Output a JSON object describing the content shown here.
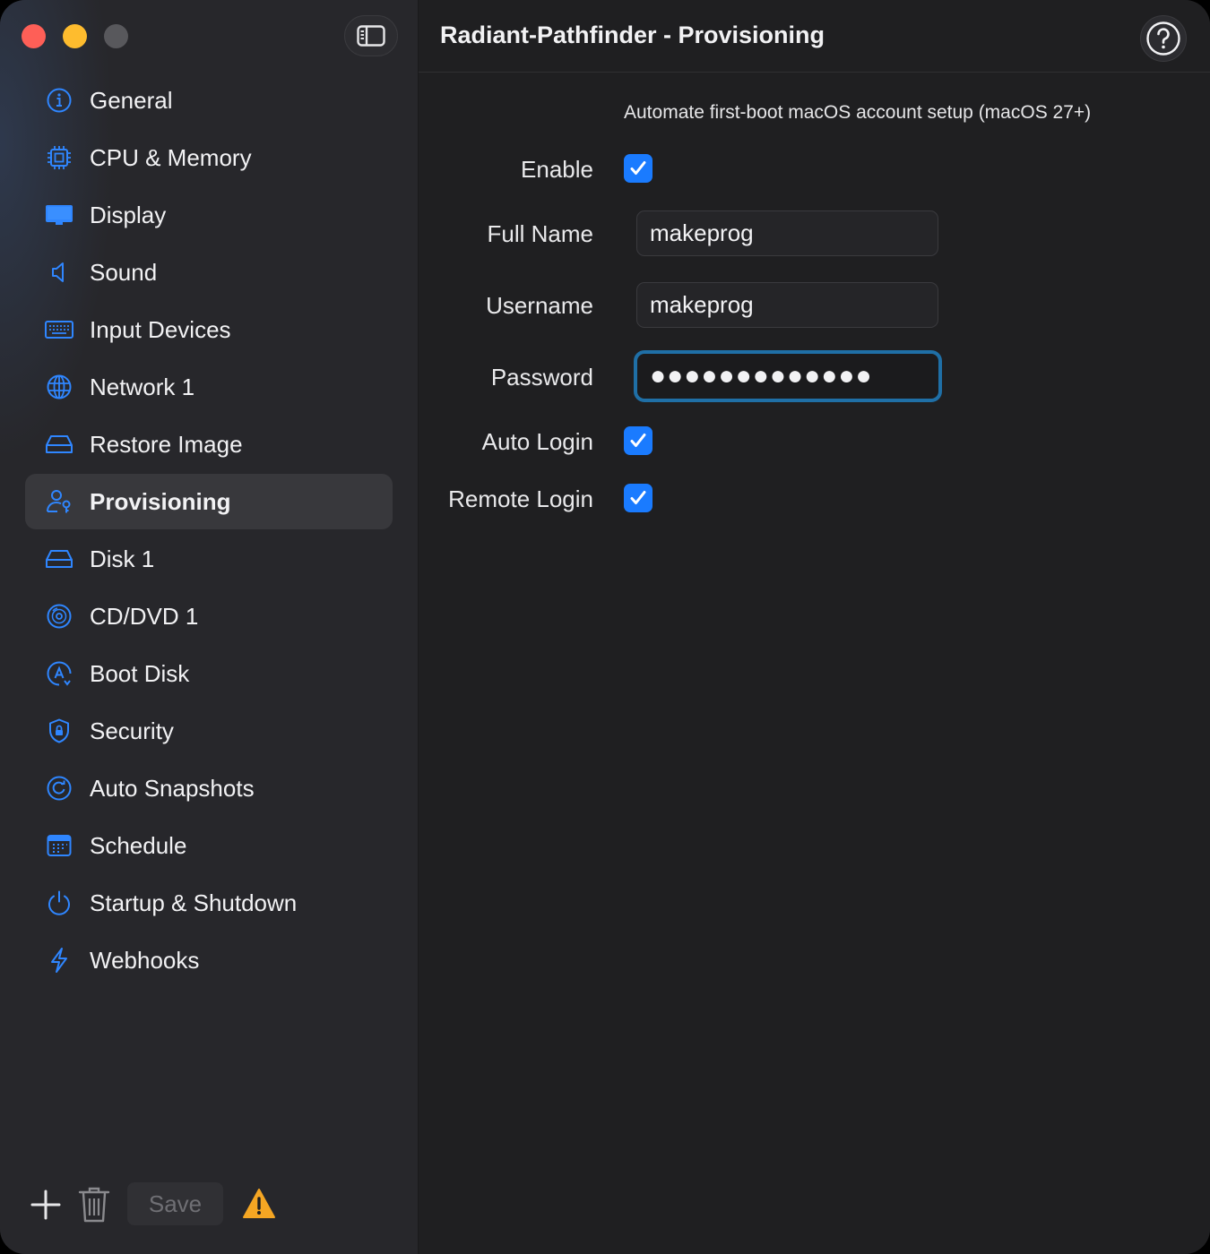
{
  "window": {
    "title": "Radiant-Pathfinder - Provisioning",
    "help_label": "?"
  },
  "sidebar": {
    "items": [
      {
        "label": "General",
        "icon": "info-circle-icon"
      },
      {
        "label": "CPU & Memory",
        "icon": "cpu-chip-icon"
      },
      {
        "label": "Display",
        "icon": "display-icon"
      },
      {
        "label": "Sound",
        "icon": "speaker-icon"
      },
      {
        "label": "Input Devices",
        "icon": "keyboard-icon"
      },
      {
        "label": "Network 1",
        "icon": "globe-icon"
      },
      {
        "label": "Restore Image",
        "icon": "drive-icon"
      },
      {
        "label": "Provisioning",
        "icon": "person-key-icon",
        "selected": true
      },
      {
        "label": "Disk 1",
        "icon": "drive-icon"
      },
      {
        "label": "CD/DVD 1",
        "icon": "disc-icon"
      },
      {
        "label": "Boot Disk",
        "icon": "boot-disk-icon"
      },
      {
        "label": "Security",
        "icon": "shield-lock-icon"
      },
      {
        "label": "Auto Snapshots",
        "icon": "snapshot-clock-icon"
      },
      {
        "label": "Schedule",
        "icon": "calendar-icon"
      },
      {
        "label": "Startup & Shutdown",
        "icon": "power-icon"
      },
      {
        "label": "Webhooks",
        "icon": "bolt-icon"
      }
    ],
    "footer": {
      "save_label": "Save"
    }
  },
  "provisioning": {
    "description": "Automate first-boot macOS account setup (macOS 27+)",
    "enable": {
      "label": "Enable",
      "checked": true
    },
    "full_name": {
      "label": "Full Name",
      "value": "makeprog"
    },
    "username": {
      "label": "Username",
      "value": "makeprog"
    },
    "password": {
      "label": "Password",
      "value": "●●●●●●●●●●●●●"
    },
    "auto_login": {
      "label": "Auto Login",
      "checked": true
    },
    "remote_login": {
      "label": "Remote Login",
      "checked": true
    }
  },
  "colors": {
    "accent": "#1a7bff",
    "icon_blue": "#2f86ff",
    "warning": "#f5a623",
    "traffic_red": "#fe5f57",
    "traffic_yellow": "#febc2e",
    "traffic_inactive": "#58585c"
  }
}
